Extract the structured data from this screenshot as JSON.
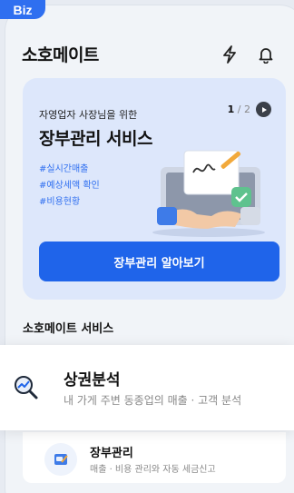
{
  "badge": "Biz",
  "header": {
    "title": "소호메이트",
    "icons": [
      "lightning-icon",
      "bell-icon"
    ]
  },
  "banner": {
    "subtitle": "자영업자 사장님을 위한",
    "title": "장부관리 서비스",
    "tags": [
      "#실시간매출",
      "#예상세액 확인",
      "#비용현황"
    ],
    "pager": {
      "current": "1",
      "total": "/ 2"
    },
    "cta_label": "장부관리 알아보기"
  },
  "section_title": "소호메이트 서비스",
  "services": [
    {
      "title": "상권분석",
      "desc": "내 가게 주변 동종업의 매출 · 고객 분석",
      "icon": "chart-magnifier-icon"
    },
    {
      "title": "장부관리",
      "desc": "매출 · 비용 관리와 자동 세금신고",
      "icon": "ledger-icon"
    }
  ],
  "colors": {
    "primary": "#1f64ea",
    "banner_bg": "#dde7fb",
    "badge_bg": "#2f6ff0"
  }
}
